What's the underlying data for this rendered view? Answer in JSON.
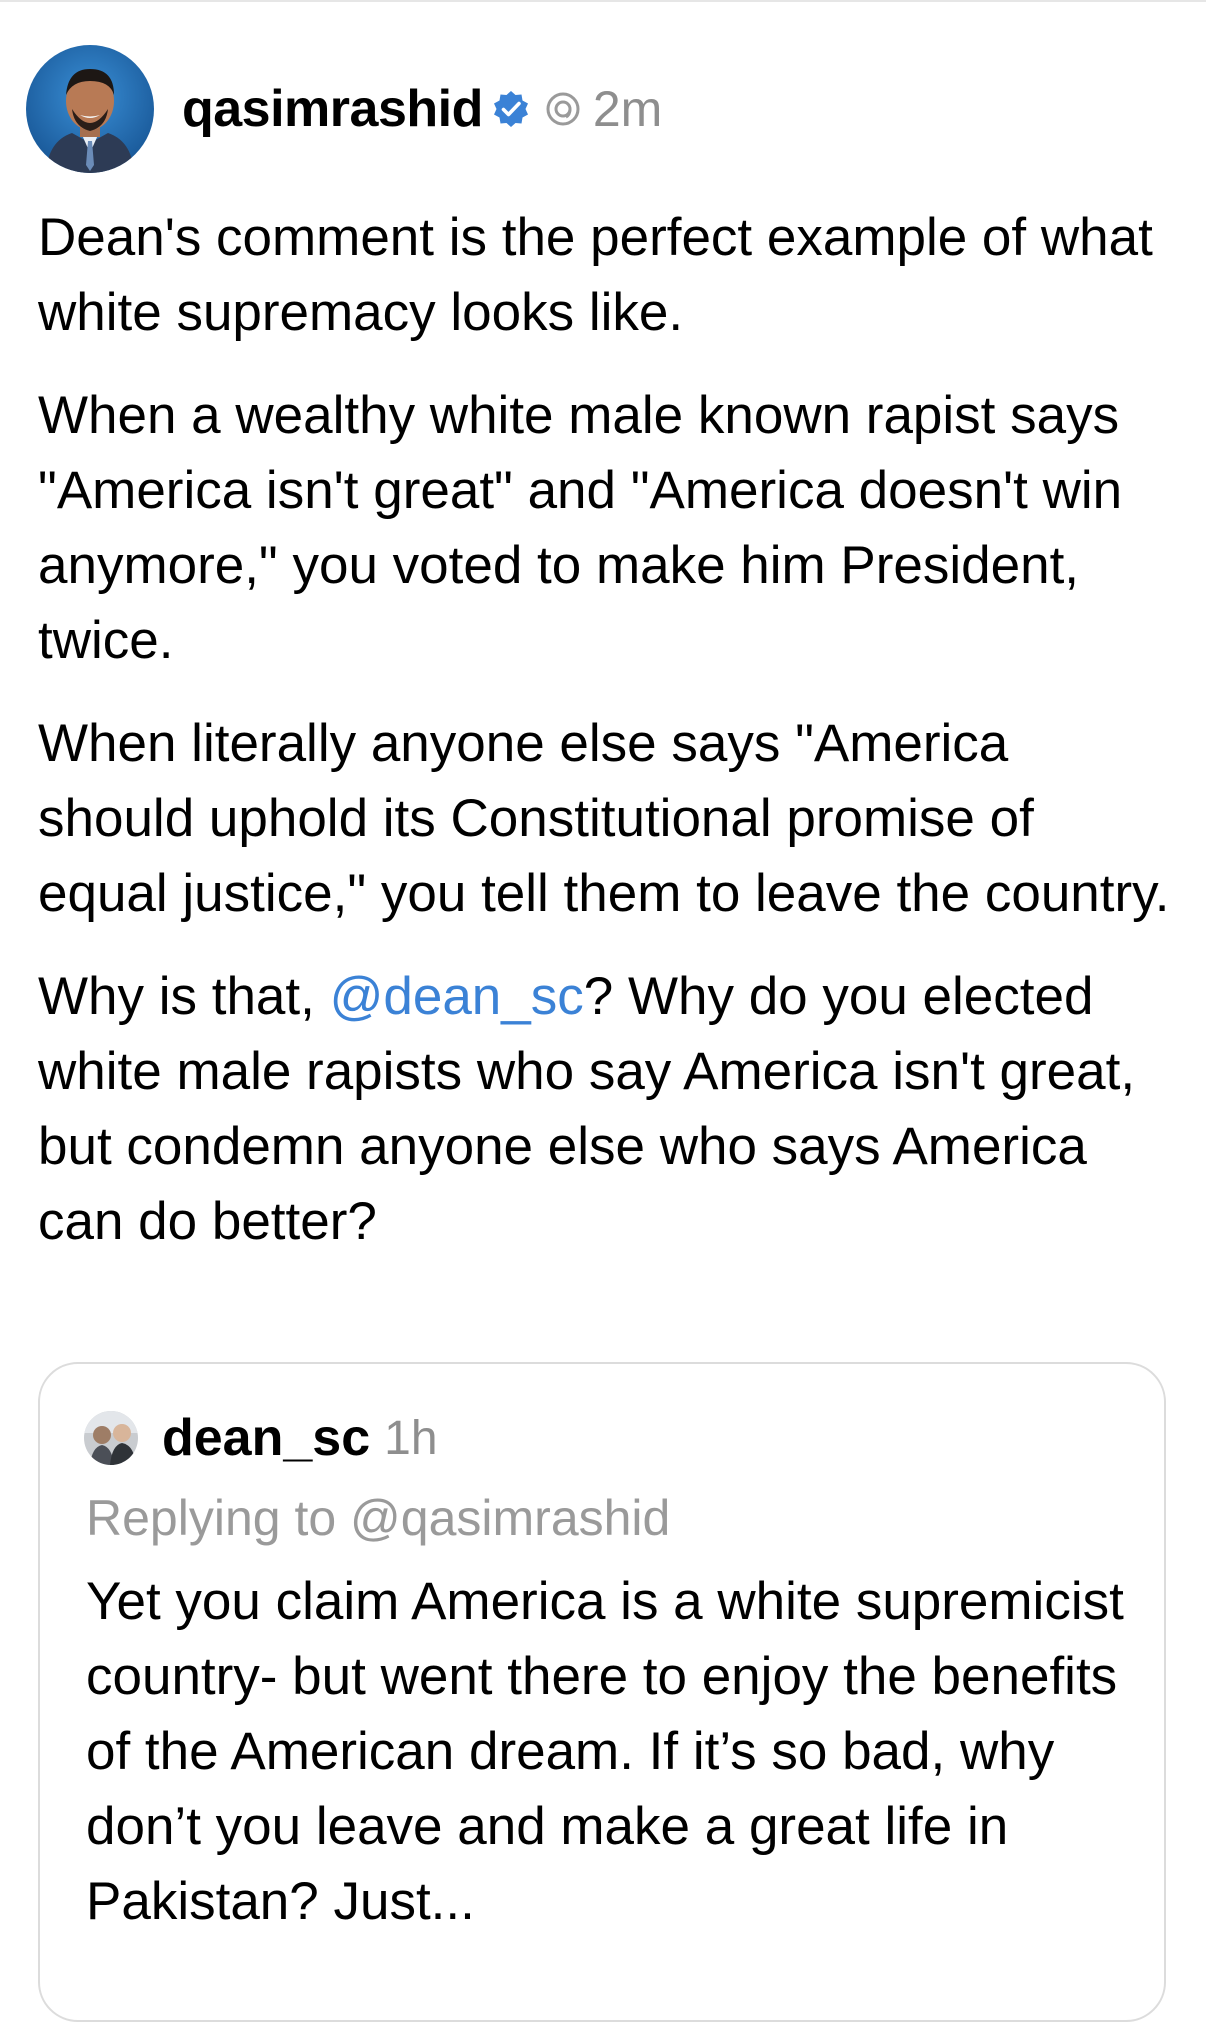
{
  "post": {
    "author": {
      "username": "qasimrashid",
      "verified_icon": "verified-badge-icon",
      "threads_icon": "threads-logo-icon",
      "timestamp": "2m"
    },
    "paragraphs": {
      "p1": "Dean's comment is the perfect example of what white supremacy looks like.",
      "p2": "When a wealthy white male known rapist says \"America isn't great\" and \"America doesn't win anymore,\" you voted to make him President, twice.",
      "p3": "When literally anyone else says \"America should uphold its Constitutional promise of equal justice,\" you tell them to leave the country.",
      "p4_before": "Why is that, ",
      "p4_mention": "@dean_sc",
      "p4_after": "? Why do you elected white male rapists who say America isn't great, but condemn anyone else who says America can do better?"
    }
  },
  "quoted_post": {
    "username": "dean_sc",
    "timestamp": "1h",
    "replying_to": "Replying to @qasimrashid",
    "text": "Yet you claim America is a white supremicist country- but went there to enjoy the benefits of the American dream. If it’s so bad, why don’t you leave and make a great life in Pakistan? Just..."
  },
  "colors": {
    "mention": "#3b82d6",
    "verified": "#3b82d6",
    "muted": "#8e8e8e",
    "card_border": "#dcdcdc"
  }
}
